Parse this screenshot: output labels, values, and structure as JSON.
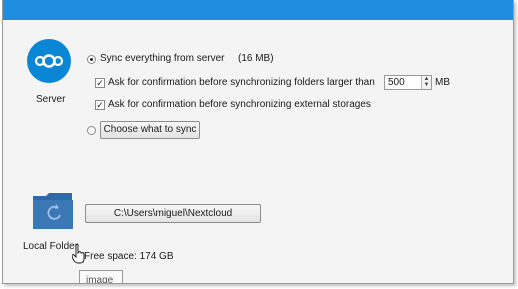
{
  "server": {
    "label": "Server",
    "sync_everything_label": "Sync everything from server",
    "sync_size": "(16 MB)",
    "ask_large_label": "Ask for confirmation before synchronizing folders larger than",
    "size_limit_value": "500",
    "size_unit": "MB",
    "ask_external_label": "Ask for confirmation before synchronizing external storages",
    "choose_button": "Choose what to sync"
  },
  "local": {
    "label": "Local Folder",
    "path_button": "C:\\Users\\miguel\\Nextcloud",
    "free_space": "Free space: 174 GB"
  },
  "tooltip": {
    "text": "image"
  },
  "colors": {
    "titlebar": "#1f8de0",
    "nextcloud_blue": "#0a86d6",
    "folder_blue": "#3c78b6"
  },
  "icons": {
    "server": "nextcloud-logo-icon",
    "folder": "folder-sync-icon",
    "cursor": "hand-pointer-icon"
  }
}
